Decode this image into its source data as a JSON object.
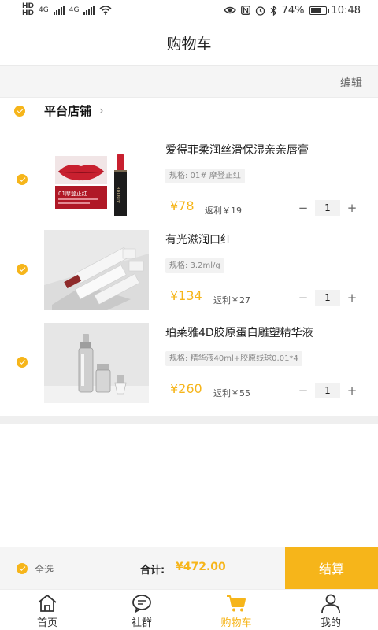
{
  "status_bar": {
    "hd_labels": [
      "HD",
      "HD"
    ],
    "network_labels": [
      "4G",
      "4G"
    ],
    "battery_text": "74%",
    "battery_level": 0.74,
    "time": "10:48"
  },
  "header": {
    "title": "购物车"
  },
  "toolbar": {
    "edit_label": "编辑"
  },
  "store": {
    "name": "平台店铺",
    "chevron": "›"
  },
  "items": [
    {
      "title": "爱得菲柔润丝滑保湿亲亲唇膏",
      "spec": "规格: 01# 摩登正红",
      "price": "¥78",
      "rebate": "返利￥19",
      "quantity": "1",
      "image_caption": "01摩登正红",
      "image_brand": "ADORE"
    },
    {
      "title": "有光滋润口红",
      "spec": "规格: 3.2ml/g",
      "price": "¥134",
      "rebate": "返利￥27",
      "quantity": "1"
    },
    {
      "title": "珀莱雅4D胶原蛋白雕塑精华液",
      "spec": "规格: 精华液40ml+胶原线球0.01*4",
      "price": "¥260",
      "rebate": "返利￥55",
      "quantity": "1"
    }
  ],
  "stepper": {
    "minus": "−",
    "plus": "+"
  },
  "footer": {
    "select_all_label": "全选",
    "total_label": "合计:",
    "total_value": "¥472.00",
    "checkout_label": "结算"
  },
  "tabs": [
    {
      "label": "首页",
      "icon": "home-icon",
      "active": false
    },
    {
      "label": "社群",
      "icon": "chat-icon",
      "active": false
    },
    {
      "label": "购物车",
      "icon": "cart-icon",
      "active": true
    },
    {
      "label": "我的",
      "icon": "user-icon",
      "active": false
    }
  ],
  "colors": {
    "accent": "#f6b51a",
    "text": "#222222",
    "muted": "#888888",
    "band": "#efefef"
  }
}
